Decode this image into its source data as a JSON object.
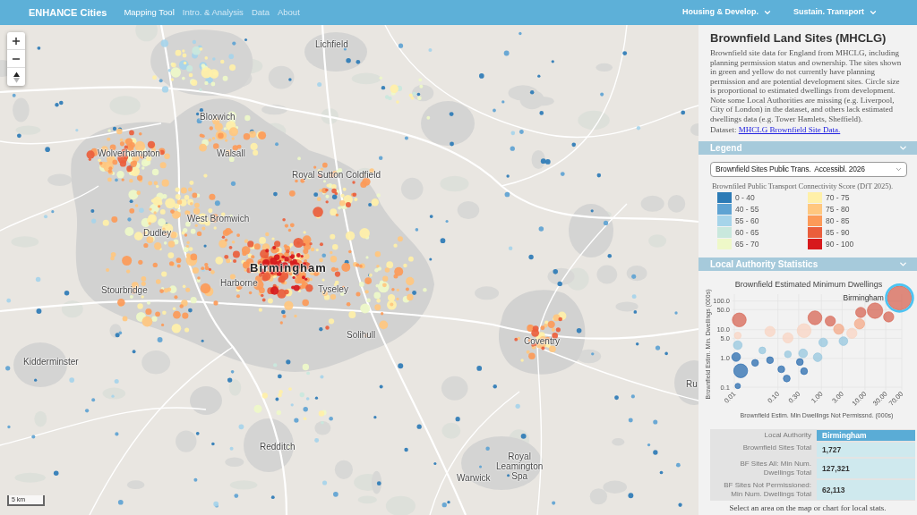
{
  "header": {
    "logo": "ENHANCE Cities",
    "nav": [
      {
        "label": "Mapping Tool",
        "selected": true
      },
      {
        "label": "Intro. & Analysis",
        "selected": false
      },
      {
        "label": "Data",
        "selected": false
      },
      {
        "label": "About",
        "selected": false
      }
    ],
    "menus": [
      "Housing & Develop.",
      "Sustain. Transport"
    ]
  },
  "map": {
    "labels": [
      {
        "text": "Lichfield",
        "kind": "town"
      },
      {
        "text": "Bloxwich",
        "kind": "town"
      },
      {
        "text": "Wolverhampton",
        "kind": "town"
      },
      {
        "text": "Walsall",
        "kind": "town"
      },
      {
        "text": "Royal Sutton Coldfield",
        "kind": "town"
      },
      {
        "text": "West Bromwich",
        "kind": "town"
      },
      {
        "text": "Dudley",
        "kind": "town"
      },
      {
        "text": "Birmingham",
        "kind": "city"
      },
      {
        "text": "Stourbridge",
        "kind": "town"
      },
      {
        "text": "Harborne",
        "kind": "town"
      },
      {
        "text": "Tyseley",
        "kind": "town"
      },
      {
        "text": "Solihull",
        "kind": "town"
      },
      {
        "text": "Coventry",
        "kind": "town"
      },
      {
        "text": "Kidderminster",
        "kind": "town"
      },
      {
        "text": "Ru",
        "kind": "town"
      },
      {
        "text": "Redditch",
        "kind": "town"
      },
      {
        "text": "Warwick",
        "kind": "town"
      },
      {
        "text": "Royal Leamington Spa",
        "kind": "town"
      }
    ],
    "scale": "5 km"
  },
  "panel": {
    "title": "Brownfield Land Sites (MHCLG)",
    "description": "Brownfield site data for England from MHCLG, including planning permission status and ownership. The sites shown in green and yellow do not currently have planning permission and are potential development sites. Circle size is proportional to estimated dwellings from development. Note some Local Authorities are missing (e.g. Liverpool, City of London) in the dataset, and others lack estimated dwellings data (e.g. Tower Hamlets, Sheffield).",
    "dataset_label": "Dataset:",
    "dataset_link": "MHCLG Brownfield Site Data.",
    "legend": {
      "header": "Legend",
      "select_value": "Brownfield Sites Public Trans.  Accessibl. 2026",
      "caption": "Brownfiled Public Transport Connectivity Score (DfT 2025).",
      "items": [
        {
          "label": "0 - 40",
          "color": "#2c7bb6"
        },
        {
          "label": "40 - 55",
          "color": "#5ea3d3"
        },
        {
          "label": "55 - 60",
          "color": "#a6d4ea"
        },
        {
          "label": "60 - 65",
          "color": "#c9e8dd"
        },
        {
          "label": "65 - 70",
          "color": "#eef8c8"
        },
        {
          "label": "70 - 75",
          "color": "#fff0a8"
        },
        {
          "label": "75 - 80",
          "color": "#ffc77f"
        },
        {
          "label": "80 - 85",
          "color": "#fc9a58"
        },
        {
          "label": "85 - 90",
          "color": "#ea5e3c"
        },
        {
          "label": "90 - 100",
          "color": "#d7191c"
        }
      ]
    },
    "stats": {
      "header": "Local Authority Statistics",
      "chart": {
        "title": "Brownfield Estimated Minimum Dwellings",
        "highlight_label": "Birmingham",
        "ylabel": "Brownfield Estim. Min. Dwellings (000s)",
        "y_tick_labels": [
          "100.0",
          "50.0",
          "10.0",
          "5.0",
          "1.0",
          "0.1"
        ],
        "x_tick_labels": [
          "0.01",
          "0.10",
          "0.30",
          "1.00",
          "3.00",
          "10.00",
          "30.00",
          "70.00"
        ],
        "xlabel": "Brownfield Estim. Min Dwellings Not Permissnd. (000s)"
      },
      "table": [
        {
          "label": "Local Authority",
          "value": "Birmingham",
          "kind": "header"
        },
        {
          "label": "Brownfield Sites Total",
          "value": "1,727",
          "kind": "value"
        },
        {
          "label": "BF Sites All: Min Num. Dwellings Total",
          "value": "127,321",
          "kind": "value"
        },
        {
          "label": "BF Sites Not Permissioned: Min Num. Dwellings Total",
          "value": "62,113",
          "kind": "value"
        }
      ],
      "footer": "Select an area on the map or chart for local stats."
    }
  }
}
